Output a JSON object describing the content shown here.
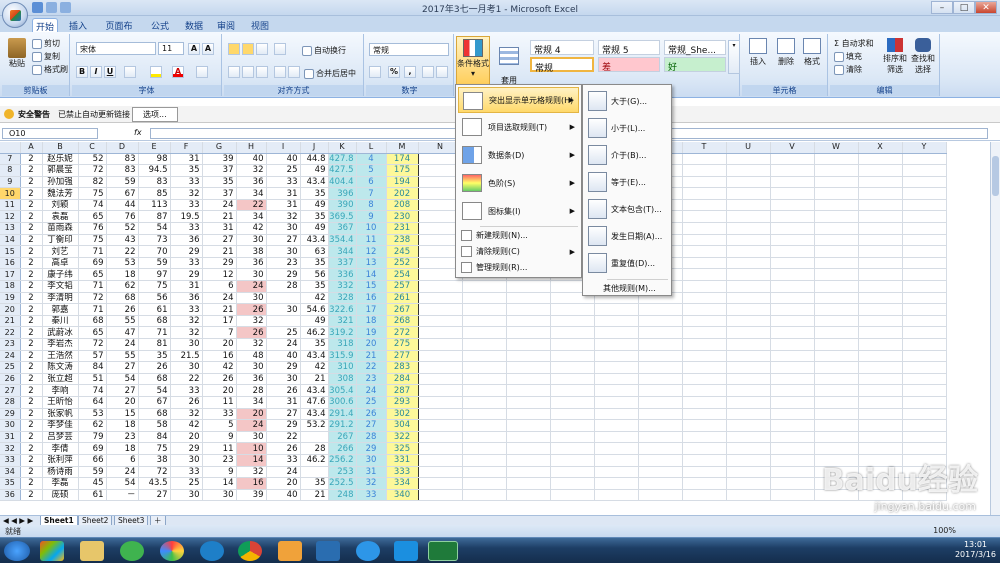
{
  "window": {
    "title": "2017年3七一月考1 - Microsoft Excel"
  },
  "tabs": [
    {
      "label": "开始",
      "active": true
    },
    {
      "label": "插入"
    },
    {
      "label": "页面布局"
    },
    {
      "label": "公式"
    },
    {
      "label": "数据"
    },
    {
      "label": "审阅"
    },
    {
      "label": "视图"
    }
  ],
  "ribbon": {
    "clipboard": {
      "paste": "粘贴",
      "cut": "剪切",
      "copy": "复制",
      "format_painter": "格式刷",
      "label": "剪贴板"
    },
    "font": {
      "name": "宋体",
      "size": "11",
      "label": "字体",
      "bold": "B",
      "italic": "I",
      "underline": "U"
    },
    "alignment": {
      "wrap": "自动换行",
      "merge": "合并后居中",
      "label": "对齐方式"
    },
    "number": {
      "format": "常规",
      "pct": "%",
      "comma": ",",
      "label": "数字"
    },
    "styles": {
      "cond_format": "条件格式",
      "table_format": "套用\n表格格式",
      "s1": "常规 4",
      "s2": "常规 5",
      "s3": "常规_She...",
      "s4": "常规",
      "s5": "差",
      "s6": "好"
    },
    "cells": {
      "insert": "插入",
      "delete": "删除",
      "format": "格式",
      "label": "单元格"
    },
    "editing": {
      "autosum": "自动求和",
      "fill": "填充",
      "clear": "清除",
      "sort": "排序和\n筛选",
      "find": "查找和\n选择",
      "label": "编辑"
    }
  },
  "security": {
    "label": "安全警告",
    "message": "已禁止自动更新链接",
    "options": "选项..."
  },
  "formula_bar": {
    "name_box": "O10",
    "fx": "fx"
  },
  "columns": [
    "A",
    "B",
    "C",
    "D",
    "E",
    "F",
    "G",
    "H",
    "I",
    "J",
    "K",
    "L",
    "M",
    "N",
    "O",
    "P",
    "Q",
    "R",
    "S",
    "T",
    "U",
    "V",
    "W",
    "X",
    "Y"
  ],
  "rows": [
    {
      "r": "7",
      "A": "2",
      "B": "赵乐妮",
      "C": "52",
      "D": "83",
      "E": "98",
      "F": "31",
      "G": "39",
      "H": "40",
      "I": "40",
      "J": "44.8",
      "K": "427.8",
      "L": "4",
      "M": "174"
    },
    {
      "r": "8",
      "A": "2",
      "B": "郭晨莹",
      "C": "72",
      "D": "83",
      "E": "94.5",
      "F": "35",
      "G": "37",
      "H": "32",
      "I": "25",
      "J": "49",
      "K": "427.5",
      "L": "5",
      "M": "175"
    },
    {
      "r": "9",
      "A": "2",
      "B": "孙加强",
      "C": "82",
      "D": "59",
      "E": "83",
      "F": "33",
      "G": "35",
      "H": "36",
      "I": "33",
      "J": "43.4",
      "K": "404.4",
      "L": "6",
      "M": "194"
    },
    {
      "r": "10",
      "A": "2",
      "B": "魏法芳",
      "C": "75",
      "D": "67",
      "E": "85",
      "F": "32",
      "G": "37",
      "H": "34",
      "I": "31",
      "J": "35",
      "K": "396",
      "L": "7",
      "M": "202"
    },
    {
      "r": "11",
      "A": "2",
      "B": "刘颖",
      "C": "74",
      "D": "44",
      "E": "113",
      "F": "33",
      "G": "24",
      "H": "22",
      "I": "31",
      "J": "49",
      "K": "390",
      "L": "8",
      "M": "208"
    },
    {
      "r": "12",
      "A": "2",
      "B": "袁磊",
      "C": "65",
      "D": "76",
      "E": "87",
      "F": "19.5",
      "G": "21",
      "H": "34",
      "I": "32",
      "J": "35",
      "K": "369.5",
      "L": "9",
      "M": "230"
    },
    {
      "r": "13",
      "A": "2",
      "B": "苗雨森",
      "C": "76",
      "D": "52",
      "E": "54",
      "F": "33",
      "G": "31",
      "H": "42",
      "I": "30",
      "J": "49",
      "K": "367",
      "L": "10",
      "M": "231"
    },
    {
      "r": "14",
      "A": "2",
      "B": "丁衡印",
      "C": "75",
      "D": "43",
      "E": "73",
      "F": "36",
      "G": "27",
      "H": "30",
      "I": "27",
      "J": "43.4",
      "K": "354.4",
      "L": "11",
      "M": "238"
    },
    {
      "r": "15",
      "A": "2",
      "B": "刘艺",
      "C": "71",
      "D": "22",
      "E": "70",
      "F": "29",
      "G": "21",
      "H": "38",
      "I": "30",
      "J": "63",
      "K": "344",
      "L": "12",
      "M": "245"
    },
    {
      "r": "16",
      "A": "2",
      "B": "高卓",
      "C": "69",
      "D": "53",
      "E": "59",
      "F": "33",
      "G": "29",
      "H": "36",
      "I": "23",
      "J": "35",
      "K": "337",
      "L": "13",
      "M": "252"
    },
    {
      "r": "17",
      "A": "2",
      "B": "康子纬",
      "C": "65",
      "D": "18",
      "E": "97",
      "F": "29",
      "G": "12",
      "H": "30",
      "I": "29",
      "J": "56",
      "K": "336",
      "L": "14",
      "M": "254"
    },
    {
      "r": "18",
      "A": "2",
      "B": "李文韬",
      "C": "71",
      "D": "62",
      "E": "75",
      "F": "31",
      "G": "6",
      "H": "24",
      "I": "28",
      "J": "35",
      "K": "332",
      "L": "15",
      "M": "257"
    },
    {
      "r": "19",
      "A": "2",
      "B": "李清明",
      "C": "72",
      "D": "68",
      "E": "56",
      "F": "36",
      "G": "24",
      "H": "30",
      "I": "",
      "J": "42",
      "K": "328",
      "L": "16",
      "M": "261"
    },
    {
      "r": "20",
      "A": "2",
      "B": "郭嘉",
      "C": "71",
      "D": "26",
      "E": "61",
      "F": "33",
      "G": "21",
      "H": "26",
      "I": "30",
      "J": "54.6",
      "K": "322.6",
      "L": "17",
      "M": "267"
    },
    {
      "r": "21",
      "A": "2",
      "B": "秦川",
      "C": "68",
      "D": "55",
      "E": "68",
      "F": "32",
      "G": "17",
      "H": "32",
      "I": "",
      "J": "49",
      "K": "321",
      "L": "18",
      "M": "268"
    },
    {
      "r": "22",
      "A": "2",
      "B": "武蔚冰",
      "C": "65",
      "D": "47",
      "E": "71",
      "F": "32",
      "G": "7",
      "H": "26",
      "I": "25",
      "J": "46.2",
      "K": "319.2",
      "L": "19",
      "M": "272"
    },
    {
      "r": "23",
      "A": "2",
      "B": "李岩杰",
      "C": "72",
      "D": "24",
      "E": "81",
      "F": "30",
      "G": "20",
      "H": "32",
      "I": "24",
      "J": "35",
      "K": "318",
      "L": "20",
      "M": "275"
    },
    {
      "r": "24",
      "A": "2",
      "B": "王浩然",
      "C": "57",
      "D": "55",
      "E": "35",
      "F": "21.5",
      "G": "16",
      "H": "48",
      "I": "40",
      "J": "43.4",
      "K": "315.9",
      "L": "21",
      "M": "277"
    },
    {
      "r": "25",
      "A": "2",
      "B": "陈文涛",
      "C": "84",
      "D": "27",
      "E": "26",
      "F": "30",
      "G": "42",
      "H": "30",
      "I": "29",
      "J": "42",
      "K": "310",
      "L": "22",
      "M": "283"
    },
    {
      "r": "26",
      "A": "2",
      "B": "张立超",
      "C": "51",
      "D": "54",
      "E": "68",
      "F": "22",
      "G": "26",
      "H": "36",
      "I": "30",
      "J": "21",
      "K": "308",
      "L": "23",
      "M": "284"
    },
    {
      "r": "27",
      "A": "2",
      "B": "李响",
      "C": "74",
      "D": "27",
      "E": "54",
      "F": "33",
      "G": "20",
      "H": "28",
      "I": "26",
      "J": "43.4",
      "K": "305.4",
      "L": "24",
      "M": "287"
    },
    {
      "r": "28",
      "A": "2",
      "B": "王昕怡",
      "C": "64",
      "D": "20",
      "E": "67",
      "F": "26",
      "G": "11",
      "H": "34",
      "I": "31",
      "J": "47.6",
      "K": "300.6",
      "L": "25",
      "M": "293"
    },
    {
      "r": "29",
      "A": "2",
      "B": "张家帆",
      "C": "53",
      "D": "15",
      "E": "68",
      "F": "32",
      "G": "33",
      "H": "20",
      "I": "27",
      "J": "43.4",
      "K": "291.4",
      "L": "26",
      "M": "302"
    },
    {
      "r": "30",
      "A": "2",
      "B": "李梦佳",
      "C": "62",
      "D": "18",
      "E": "58",
      "F": "42",
      "G": "5",
      "H": "24",
      "I": "29",
      "J": "53.2",
      "K": "291.2",
      "L": "27",
      "M": "304"
    },
    {
      "r": "31",
      "A": "2",
      "B": "吕梦芸",
      "C": "79",
      "D": "23",
      "E": "84",
      "F": "20",
      "G": "9",
      "H": "30",
      "I": "22",
      "J": "",
      "K": "267",
      "L": "28",
      "M": "322"
    },
    {
      "r": "32",
      "A": "2",
      "B": "李倩",
      "C": "69",
      "D": "18",
      "E": "75",
      "F": "29",
      "G": "11",
      "H": "10",
      "I": "26",
      "J": "28",
      "K": "266",
      "L": "29",
      "M": "325"
    },
    {
      "r": "33",
      "A": "2",
      "B": "张利萍",
      "C": "66",
      "D": "6",
      "E": "38",
      "F": "30",
      "G": "23",
      "H": "14",
      "I": "33",
      "J": "46.2",
      "K": "256.2",
      "L": "30",
      "M": "331"
    },
    {
      "r": "34",
      "A": "2",
      "B": "杨诗雨",
      "C": "59",
      "D": "24",
      "E": "72",
      "F": "33",
      "G": "9",
      "H": "32",
      "I": "24",
      "J": "",
      "K": "253",
      "L": "31",
      "M": "333"
    },
    {
      "r": "35",
      "A": "2",
      "B": "李磊",
      "C": "45",
      "D": "54",
      "E": "43.5",
      "F": "25",
      "G": "14",
      "H": "16",
      "I": "20",
      "J": "35",
      "K": "252.5",
      "L": "32",
      "M": "334"
    },
    {
      "r": "36",
      "A": "2",
      "B": "庞硕",
      "C": "61",
      "D": "－",
      "E": "27",
      "F": "30",
      "G": "30",
      "H": "39",
      "I": "40",
      "J": "21",
      "K": "248",
      "L": "33",
      "M": "340"
    }
  ],
  "sheets": [
    "Sheet1",
    "Sheet2",
    "Sheet3"
  ],
  "status": {
    "ready": "就绪",
    "zoom": "100%"
  },
  "menu": {
    "items": [
      {
        "label": "突出显示单元格规则(H)",
        "arrow": "▶"
      },
      {
        "label": "项目选取规则(T)",
        "arrow": "▶"
      },
      {
        "label": "数据条(D)",
        "arrow": "▶"
      },
      {
        "label": "色阶(S)",
        "arrow": "▶"
      },
      {
        "label": "图标集(I)",
        "arrow": "▶"
      }
    ],
    "small": [
      {
        "label": "新建规则(N)..."
      },
      {
        "label": "清除规则(C)",
        "arrow": "▶"
      },
      {
        "label": "管理规则(R)..."
      }
    ]
  },
  "submenu": {
    "items": [
      {
        "label": "大于(G)..."
      },
      {
        "label": "小于(L)..."
      },
      {
        "label": "介于(B)..."
      },
      {
        "label": "等于(E)..."
      },
      {
        "label": "文本包含(T)..."
      },
      {
        "label": "发生日期(A)..."
      },
      {
        "label": "重复值(D)..."
      }
    ],
    "more": "其他规则(M)..."
  },
  "tray": {
    "time": "13:01",
    "date": "2017/3/16"
  },
  "watermark": {
    "text": "Baidu经验",
    "url": "jingyan.baidu.com"
  }
}
